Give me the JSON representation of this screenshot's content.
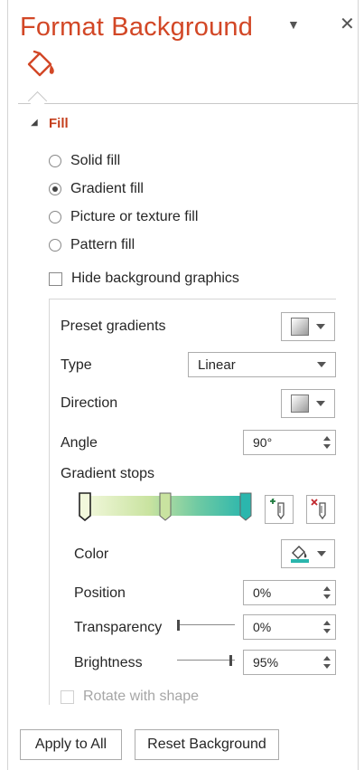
{
  "pane": {
    "title": "Format Background",
    "menu_glyph": "▼",
    "close_glyph": "✕",
    "tab_icon": "paint-bucket-icon"
  },
  "fill": {
    "section_caret": "◢",
    "section_title": "Fill",
    "options": [
      {
        "label": "Solid fill",
        "selected": false
      },
      {
        "label": "Gradient fill",
        "selected": true
      },
      {
        "label": "Picture or texture fill",
        "selected": false
      },
      {
        "label": "Pattern fill",
        "selected": false
      }
    ],
    "hide_background_graphics": {
      "label": "Hide background graphics",
      "checked": false
    }
  },
  "gradient": {
    "preset_label": "Preset gradients",
    "type_label": "Type",
    "type_value": "Linear",
    "direction_label": "Direction",
    "angle_label": "Angle",
    "angle_value": "90°",
    "stops_label": "Gradient stops",
    "stop_positions": [
      0,
      0.5,
      1
    ],
    "selected_stop": 0,
    "color_label": "Color",
    "position_label": "Position",
    "position_value": "0%",
    "transparency_label": "Transparency",
    "transparency_value": "0%",
    "transparency_level": 0,
    "brightness_label": "Brightness",
    "brightness_value": "95%",
    "brightness_level": 0.95,
    "rotate_label": "Rotate with shape",
    "rotate_enabled": false
  },
  "buttons": {
    "apply_all": "Apply to All",
    "reset": "Reset Background"
  },
  "colors": {
    "accent": "#d24726",
    "section_title": "#c43e1c",
    "gradient_stops": [
      "#f2f8dc",
      "#c9e3a0",
      "#2bb6ad"
    ],
    "color_swatch": "#2bb6ad"
  }
}
